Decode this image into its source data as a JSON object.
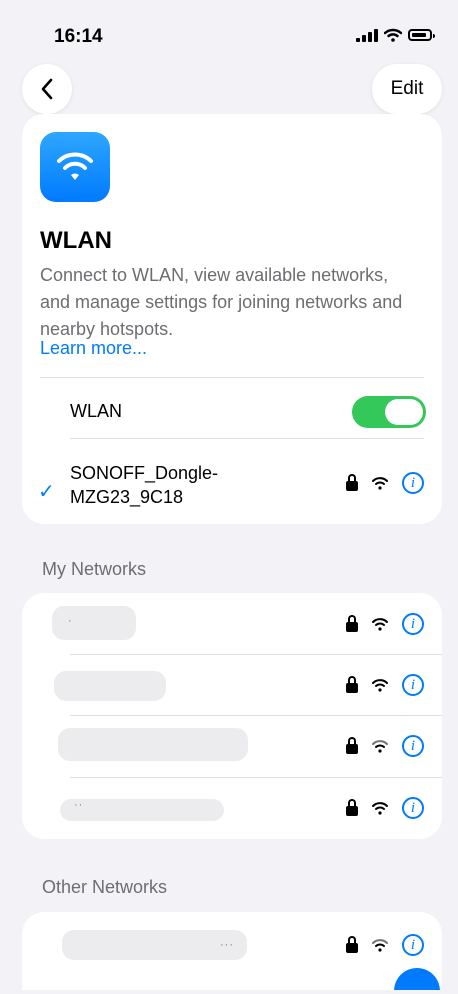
{
  "status_bar": {
    "time": "16:14"
  },
  "navigation": {
    "back_icon": "chevron-left-icon",
    "edit_label": "Edit"
  },
  "wlan_panel": {
    "title": "WLAN",
    "description": "Connect to WLAN, view available networks, and manage settings for joining networks and nearby hotspots.",
    "learn_more": "Learn more...",
    "wlan_toggle_label": "WLAN",
    "wlan_enabled": true,
    "connected_network": "SONOFF_Dongle-\nMZG23_9C18"
  },
  "sections": {
    "my_networks": "My Networks",
    "other_networks": "Other Networks"
  },
  "my_network_rows": [
    {
      "name_dots": "·"
    },
    {
      "name_dots": ""
    },
    {
      "name_dots": ""
    },
    {
      "name_dots": "··"
    }
  ],
  "other_network_rows": [
    {
      "name_dots": "···"
    }
  ],
  "colors": {
    "accent": "#007aff",
    "toggle_on": "#34c759",
    "background": "#f2f2f7"
  },
  "icons": {
    "wifi": "wifi-icon",
    "lock": "lock-icon",
    "info": "info-icon",
    "check": "checkmark-icon"
  }
}
